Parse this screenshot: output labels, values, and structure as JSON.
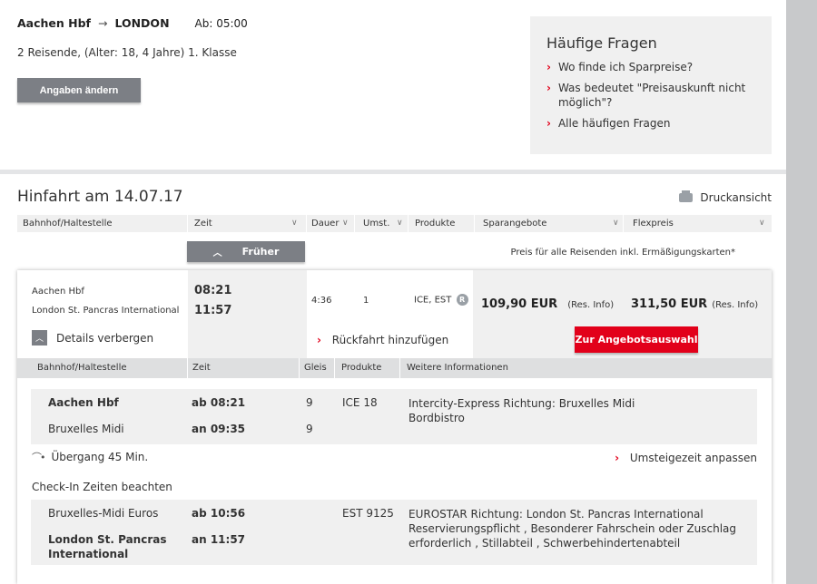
{
  "search": {
    "from": "Aachen Hbf",
    "to": "LONDON",
    "departure_label": "Ab: 05:00",
    "travellers": "2 Reisende, (Alter: 18, 4 Jahre) 1. Klasse",
    "change_button": "Angaben ändern"
  },
  "faq": {
    "title": "Häufige Fragen",
    "items": [
      "Wo finde ich Sparpreise?",
      "Was bedeutet \"Preisauskunft nicht möglich\"?",
      "Alle häufigen Fragen"
    ]
  },
  "results": {
    "title": "Hinfahrt am 14.07.17",
    "print_label": "Druckansicht",
    "columns": {
      "station": "Bahnhof/Haltestelle",
      "time": "Zeit",
      "duration": "Dauer",
      "changes": "Umst.",
      "products": "Produkte",
      "saver": "Sparangebote",
      "flex": "Flexpreis"
    },
    "earlier_button": "Früher",
    "price_note": "Preis für alle Reisenden inkl. Ermäßigungskarten*"
  },
  "connection": {
    "from": "Aachen Hbf",
    "to": "London St. Pancras International",
    "dep_time": "08:21",
    "arr_time": "11:57",
    "duration": "4:36",
    "changes": "1",
    "products": "ICE, EST",
    "reservation_badge": "R",
    "saver_price": "109,90 EUR",
    "saver_info": "(Res. Info)",
    "flex_price": "311,50 EUR",
    "flex_info": "(Res. Info)",
    "details_toggle": "Details verbergen",
    "return_link": "Rückfahrt hinzufügen",
    "offer_button": "Zur Angebotsauswahl"
  },
  "details": {
    "columns": {
      "station": "Bahnhof/Haltestelle",
      "time": "Zeit",
      "platform": "Gleis",
      "products": "Produkte",
      "info": "Weitere Informationen"
    },
    "segment1": {
      "dep_station": "Aachen Hbf",
      "dep_time": "ab 08:21",
      "dep_platform": "9",
      "product": "ICE 18",
      "info_1": "Intercity-Express Richtung: Bruxelles Midi",
      "info_2": "Bordbistro",
      "arr_station": "Bruxelles Midi",
      "arr_time": "an 09:35",
      "arr_platform": "9"
    },
    "transfer": "Übergang 45 Min.",
    "adjust_transfer": "Umsteigezeit anpassen",
    "checkin_note": "Check-In Zeiten beachten",
    "segment2": {
      "dep_station": "Bruxelles-Midi Euros",
      "dep_time": "ab 10:56",
      "product": "EST 9125",
      "info": "EUROSTAR Richtung: London St. Pancras International Reservierungspflicht , Besonderer Fahrschein oder Zuschlag erforderlich , Stillabteil , Schwerbehindertenabteil",
      "arr_station": "London St. Pancras International",
      "arr_time": "an 11:57"
    }
  }
}
